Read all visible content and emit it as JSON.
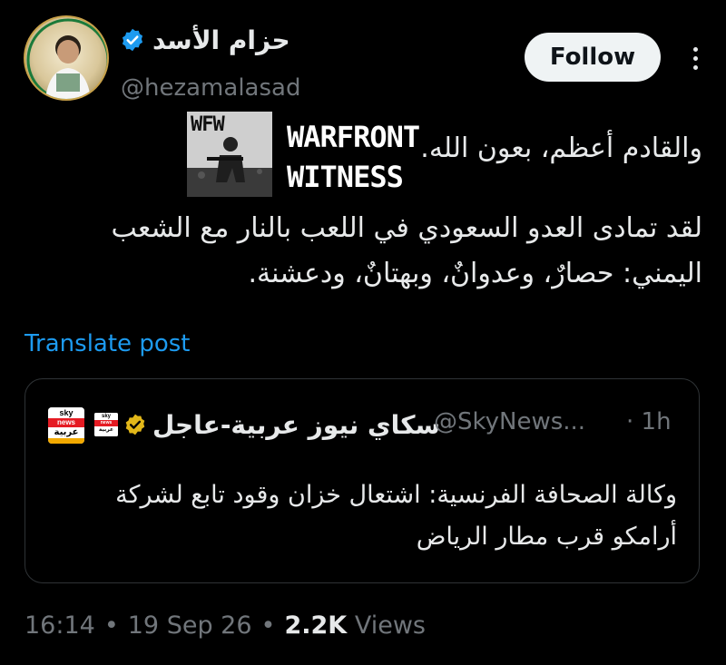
{
  "author": {
    "display_name": "حزام الأسد",
    "handle": "@hezamalasad",
    "verified": true,
    "verified_color": "#1d9bf0"
  },
  "follow_button": {
    "label": "Follow"
  },
  "more_button": {
    "icon": "more-vertical-icon"
  },
  "post": {
    "line1": "والقادم أعظم، بعون الله.",
    "emoji_text": [
      "WARFRONT",
      "WITNESS"
    ],
    "emoji_badge": "WFW",
    "line2": "لقد تمادى العدو السعودي في اللعب بالنار مع الشعب",
    "line3": "اليمني: حصارٌ، وعدوانٌ، وبهتانٌ، ودعشنة."
  },
  "translate_link": "Translate post",
  "quoted": {
    "logo": {
      "top": "sky",
      "mid": "news",
      "bottom": "عربية",
      "sub": "عاجل"
    },
    "display_name": "سكاي نيوز عربية-عاجل",
    "verified_color": "#e2b719",
    "handle": "@SkyNews...",
    "time": "· 1h",
    "line1": "وكالة الصحافة الفرنسية: اشتعال خزان وقود تابع لشركة",
    "line2": "أرامكو قرب مطار الرياض"
  },
  "footer": {
    "time": "16:14",
    "sep1": "•",
    "date": "19 Sep 26",
    "sep2": "•",
    "views_count": "2.2K",
    "views_label": "Views"
  },
  "colors": {
    "background": "#000000",
    "text": "#e7e9ea",
    "muted": "#71767b",
    "link": "#1d9bf0"
  }
}
